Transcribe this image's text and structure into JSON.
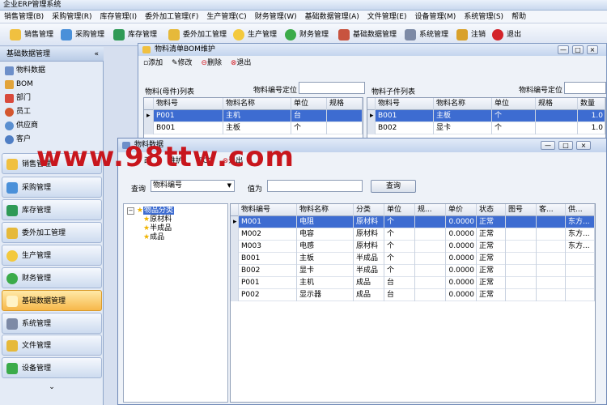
{
  "app_title": "企业ERP管理系统",
  "menu": [
    "销售管理(B)",
    "采购管理(R)",
    "库存管理(I)",
    "委外加工管理(F)",
    "生产管理(C)",
    "财务管理(W)",
    "基础数据管理(A)",
    "文件管理(E)",
    "设备管理(M)",
    "系统管理(S)",
    "帮助"
  ],
  "toolbar": [
    "销售管理",
    "采购管理",
    "库存管理",
    "委外加工管理",
    "生产管理",
    "财务管理",
    "基础数据管理",
    "系统管理",
    "注销",
    "退出"
  ],
  "sidebar": {
    "header": "基础数据管理",
    "collapse": "«",
    "tree": [
      "物料数据",
      "BOM",
      "部门",
      "员工",
      "供应商",
      "客户"
    ],
    "nav": [
      "销售管理",
      "采购管理",
      "库存管理",
      "委外加工管理",
      "生产管理",
      "财务管理",
      "基础数据管理",
      "系统管理",
      "文件管理",
      "设备管理"
    ],
    "active_nav": "基础数据管理",
    "more": "⌄"
  },
  "bom": {
    "title": "物料清单BOM维护",
    "toolbar": [
      "添加",
      "修改",
      "删除",
      "退出"
    ],
    "parent_label": "物料(母件)列表",
    "parent_locate": "物料编号定位",
    "child_label": "物料子件列表",
    "child_locate": "物料编号定位",
    "parent_headers": [
      "物料号",
      "物料名称",
      "单位",
      "规格"
    ],
    "parent_rows": [
      [
        "P001",
        "主机",
        "台",
        ""
      ],
      [
        "B001",
        "主板",
        "个",
        ""
      ]
    ],
    "child_headers": [
      "物料号",
      "物料名称",
      "单位",
      "规格",
      "数量"
    ],
    "child_rows": [
      [
        "B001",
        "主板",
        "个",
        "",
        "1.0"
      ],
      [
        "B002",
        "显卡",
        "个",
        "",
        "1.0"
      ]
    ]
  },
  "material": {
    "title": "物料数据",
    "toolbar_visible": [
      "改",
      "维护",
      "ECO",
      "退出"
    ],
    "query_label": "查询",
    "query_field": "物料编号",
    "value_label": "值为",
    "query_button": "查询",
    "tree_root": "物品分类",
    "tree_children": [
      "原材料",
      "半成品",
      "成品"
    ],
    "headers": [
      "物料编号",
      "物料名称",
      "分类",
      "单位",
      "规...",
      "单价",
      "状态",
      "图号",
      "客...",
      "供..."
    ],
    "rows": [
      [
        "M001",
        "电阻",
        "原材料",
        "个",
        "",
        "0.0000",
        "正常",
        "",
        "",
        "东方..."
      ],
      [
        "M002",
        "电容",
        "原材料",
        "个",
        "",
        "0.0000",
        "正常",
        "",
        "",
        "东方..."
      ],
      [
        "M003",
        "电感",
        "原材料",
        "个",
        "",
        "0.0000",
        "正常",
        "",
        "",
        "东方..."
      ],
      [
        "B001",
        "主板",
        "半成品",
        "个",
        "",
        "0.0000",
        "正常",
        "",
        "",
        ""
      ],
      [
        "B002",
        "显卡",
        "半成品",
        "个",
        "",
        "0.0000",
        "正常",
        "",
        "",
        ""
      ],
      [
        "P001",
        "主机",
        "成品",
        "台",
        "",
        "0.0000",
        "正常",
        "",
        "",
        ""
      ],
      [
        "P002",
        "显示器",
        "成品",
        "台",
        "",
        "0.0000",
        "正常",
        "",
        "",
        ""
      ]
    ]
  },
  "watermark": "www.98ttw.com",
  "colors": {
    "selection": "#3d6cd1",
    "active_nav": "#f7b84a",
    "watermark": "#c8161d"
  }
}
